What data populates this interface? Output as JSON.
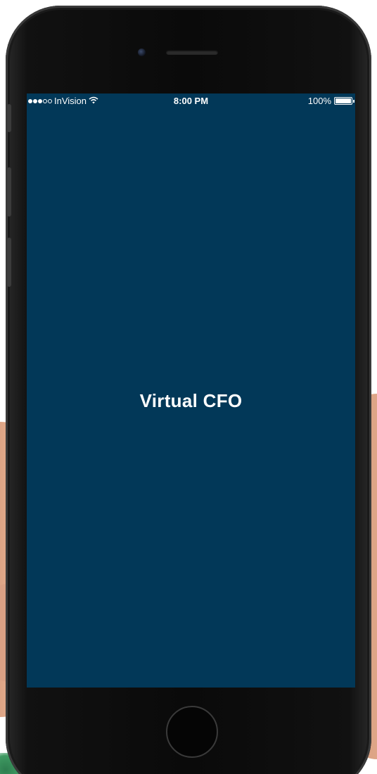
{
  "status_bar": {
    "carrier": "InVision",
    "time": "8:00 PM",
    "battery_text": "100%",
    "signal_bars_filled": 3,
    "signal_bars_total": 5,
    "battery_level": 1.0,
    "wifi_icon": "wifi-icon"
  },
  "screen": {
    "title": "Virtual CFO",
    "background_color": "#023858"
  },
  "device": {
    "home_button_icon": "home-button",
    "camera_icon": "front-camera-icon",
    "speaker_icon": "earpiece-speaker-icon"
  }
}
